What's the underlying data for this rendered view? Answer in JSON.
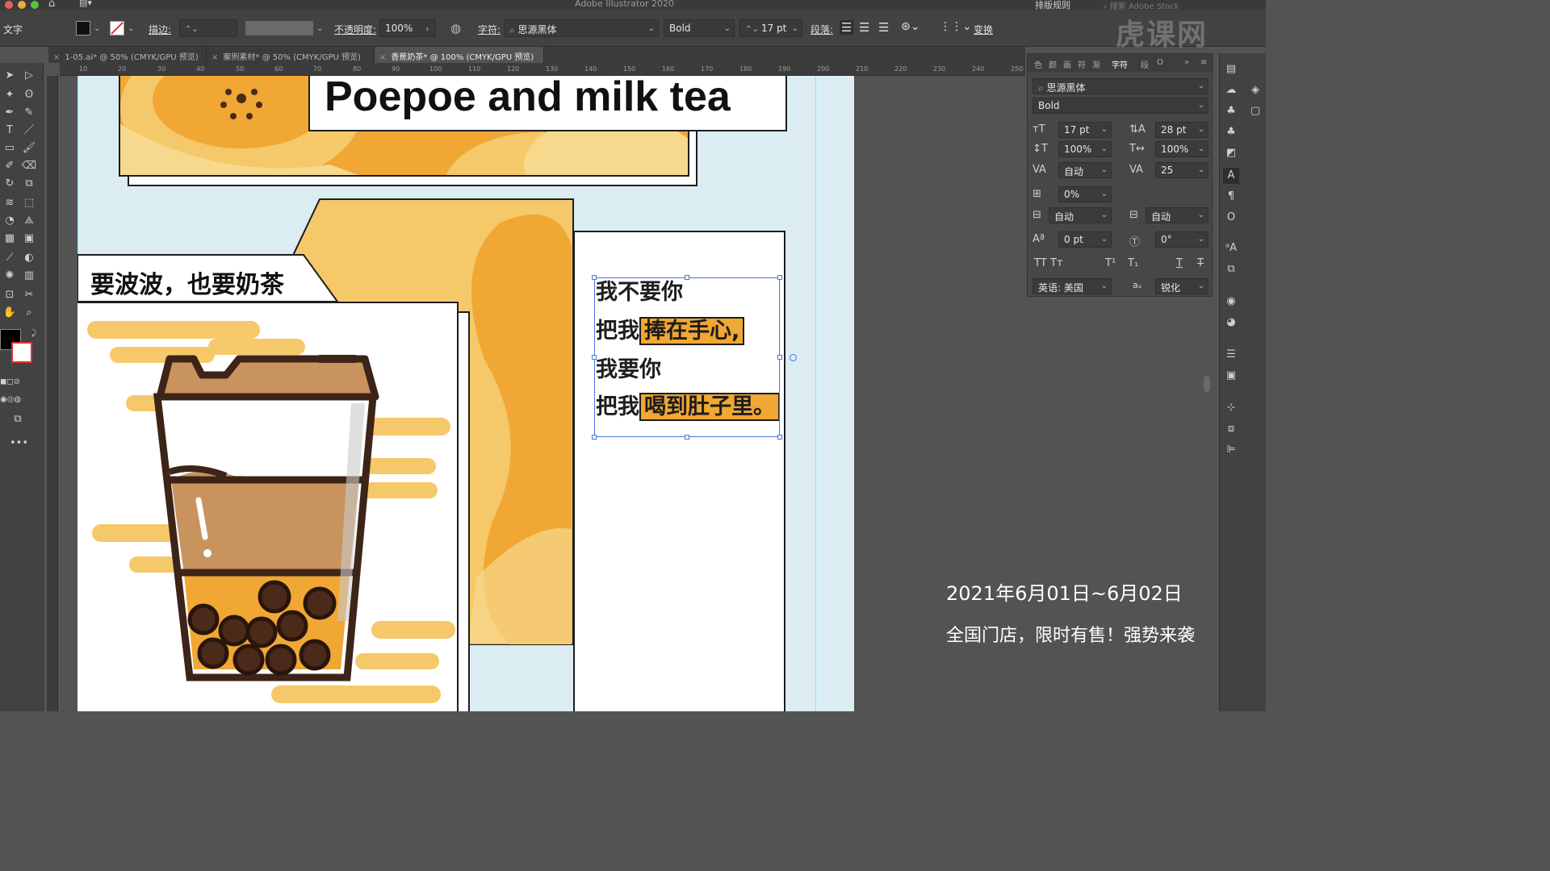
{
  "window": {
    "app_title": "Adobe Illustrator 2020",
    "layout_menu": "排版规则",
    "stock_search_placeholder": "搜索 Adobe Stock"
  },
  "control_bar": {
    "tool_name": "文字",
    "stroke_label": "描边:",
    "opacity_label": "不透明度:",
    "opacity_value": "100%",
    "char_label": "字符:",
    "font_family": "思源黑体",
    "font_style": "Bold",
    "font_size": "17 pt",
    "paragraph_label": "段落:",
    "transform_label": "变换"
  },
  "tabs": [
    {
      "label": "1-05.ai* @ 50% (CMYK/GPU 预览)",
      "active": false
    },
    {
      "label": "案例素材* @ 50% (CMYK/GPU 预览)",
      "active": false
    },
    {
      "label": "香蕉奶茶* @ 100% (CMYK/GPU 预览)",
      "active": true
    }
  ],
  "ruler_ticks": [
    "10",
    "20",
    "30",
    "40",
    "50",
    "60",
    "70",
    "80",
    "90",
    "100",
    "110",
    "120",
    "130",
    "140",
    "150",
    "160",
    "170",
    "180",
    "190",
    "200",
    "210",
    "220",
    "230",
    "240",
    "250"
  ],
  "artwork": {
    "headline": "Poepoe and milk tea",
    "subheadline": "要波波，也要奶茶",
    "verse_lines": [
      {
        "plain": "我不要你",
        "highlight": ""
      },
      {
        "plain": "把我",
        "highlight": "捧在手心,"
      },
      {
        "plain": "我要你",
        "highlight": ""
      },
      {
        "plain": "把我",
        "highlight": "喝到肚子里。"
      }
    ],
    "date_text": "2021年6月01日~6月02日",
    "promo_text": "全国门店，限时有售！强势来袭"
  },
  "character_panel": {
    "tab_labels": [
      "色",
      "颜",
      "画",
      "符",
      "渐",
      "字符",
      "段",
      "OpenType"
    ],
    "active_tab": "字符",
    "font_family": "思源黑体",
    "font_style": "Bold",
    "font_size": "17 pt",
    "leading": "28 pt",
    "vertical_scale": "100%",
    "horizontal_scale": "100%",
    "kerning": "自动",
    "tracking": "25",
    "tsume": "0%",
    "aki_left": "自动",
    "aki_right": "自动",
    "baseline_shift": "0 pt",
    "rotation": "0°",
    "language": "英语: 美国",
    "antialias_label": "aₐ",
    "antialias": "锐化"
  },
  "watermark_text": "虎课网",
  "colors": {
    "artboard": "#dcecf3",
    "orange": "#f0a733",
    "light_orange": "#f5c869",
    "pale_yellow": "#f7d98e",
    "cup_brown": "#3d2418",
    "tea": "#c8935d"
  }
}
